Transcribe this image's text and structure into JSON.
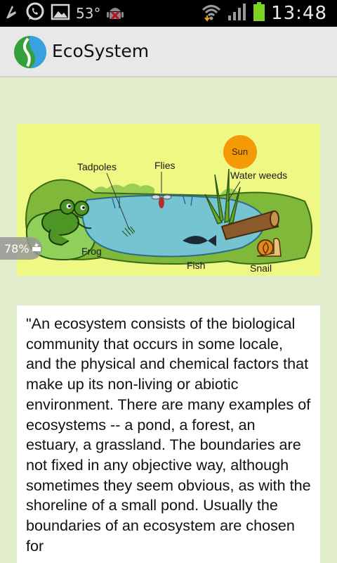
{
  "status_bar": {
    "temperature": "53°",
    "time": "13:48",
    "icons": [
      "usb-debug-icon",
      "whatsapp-icon",
      "gallery-icon",
      "android-update-icon",
      "wifi-icon",
      "signal-icon",
      "battery-icon"
    ]
  },
  "app_bar": {
    "title": "EcoSystem",
    "logo_icon": "ecosystem-logo-icon"
  },
  "illustration": {
    "labels": {
      "tadpoles": "Tadpoles",
      "flies": "Flies",
      "sun": "Sun",
      "water_weeds": "Water weeds",
      "frog": "Frog",
      "fish": "Fish",
      "snail": "Snail"
    }
  },
  "battery_toast": {
    "text": "78%"
  },
  "article": {
    "text": "\"An ecosystem consists of the biological community that occurs in some locale, and the physical and chemical factors that make up its non-living or abiotic environment. There are many examples of ecosystems -- a pond, a forest, an estuary, a grassland. The boundaries are not fixed in any objective way, although sometimes they seem obvious, as with the shoreline of a small pond. Usually the boundaries of an ecosystem are chosen for"
  },
  "colors": {
    "page_bg": "#e1ecca",
    "appbar_bg": "#e8e8e8",
    "illustration_bg": "#eef883",
    "pond": "#76c3d2",
    "sun": "#f59a07",
    "battery_green": "#7cd322"
  }
}
